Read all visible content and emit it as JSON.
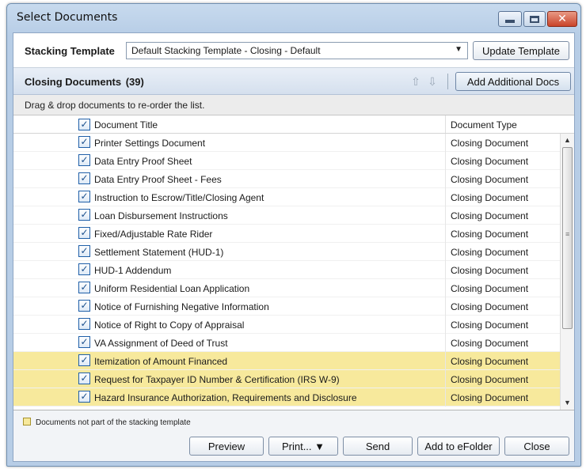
{
  "window": {
    "title": "Select Documents",
    "accent": "#c7daee",
    "highlight_color": "#f7e99c"
  },
  "stacking": {
    "label": "Stacking Template",
    "selected": "Default Stacking Template - Closing - Default",
    "update_label": "Update Template"
  },
  "section": {
    "title": "Closing Documents",
    "count": "(39)",
    "add_label": "Add Additional Docs"
  },
  "hint": "Drag & drop documents to re-order the list.",
  "grid": {
    "col_title": "Document Title",
    "col_type": "Document Type",
    "rows": [
      {
        "title": "Printer Settings Document",
        "type": "Closing Document",
        "checked": true,
        "highlight": false
      },
      {
        "title": "Data Entry Proof Sheet",
        "type": "Closing Document",
        "checked": true,
        "highlight": false
      },
      {
        "title": "Data Entry Proof Sheet - Fees",
        "type": "Closing Document",
        "checked": true,
        "highlight": false
      },
      {
        "title": "Instruction to Escrow/Title/Closing Agent",
        "type": "Closing Document",
        "checked": true,
        "highlight": false
      },
      {
        "title": "Loan Disbursement Instructions",
        "type": "Closing Document",
        "checked": true,
        "highlight": false
      },
      {
        "title": "Fixed/Adjustable Rate Rider",
        "type": "Closing Document",
        "checked": true,
        "highlight": false
      },
      {
        "title": "Settlement Statement (HUD-1)",
        "type": "Closing Document",
        "checked": true,
        "highlight": false
      },
      {
        "title": "HUD-1 Addendum",
        "type": "Closing Document",
        "checked": true,
        "highlight": false
      },
      {
        "title": "Uniform Residential Loan Application",
        "type": "Closing Document",
        "checked": true,
        "highlight": false
      },
      {
        "title": "Notice of Furnishing Negative Information",
        "type": "Closing Document",
        "checked": true,
        "highlight": false
      },
      {
        "title": "Notice of Right to Copy of Appraisal",
        "type": "Closing Document",
        "checked": true,
        "highlight": false
      },
      {
        "title": "VA Assignment of Deed of Trust",
        "type": "Closing Document",
        "checked": true,
        "highlight": false
      },
      {
        "title": "Itemization of Amount Financed",
        "type": "Closing Document",
        "checked": true,
        "highlight": true
      },
      {
        "title": "Request for Taxpayer ID Number & Certification (IRS W-9)",
        "type": "Closing Document",
        "checked": true,
        "highlight": true
      },
      {
        "title": "Hazard Insurance Authorization, Requirements and Disclosure",
        "type": "Closing Document",
        "checked": true,
        "highlight": true
      }
    ]
  },
  "legend": "Documents not part of the stacking template",
  "buttons": {
    "preview": "Preview",
    "print": "Print... ▼",
    "send": "Send",
    "efolder": "Add to eFolder",
    "close": "Close"
  },
  "icons": {
    "up": "arrow-up-icon",
    "down": "arrow-down-icon",
    "checkbox": "checkbox-checked-icon"
  }
}
